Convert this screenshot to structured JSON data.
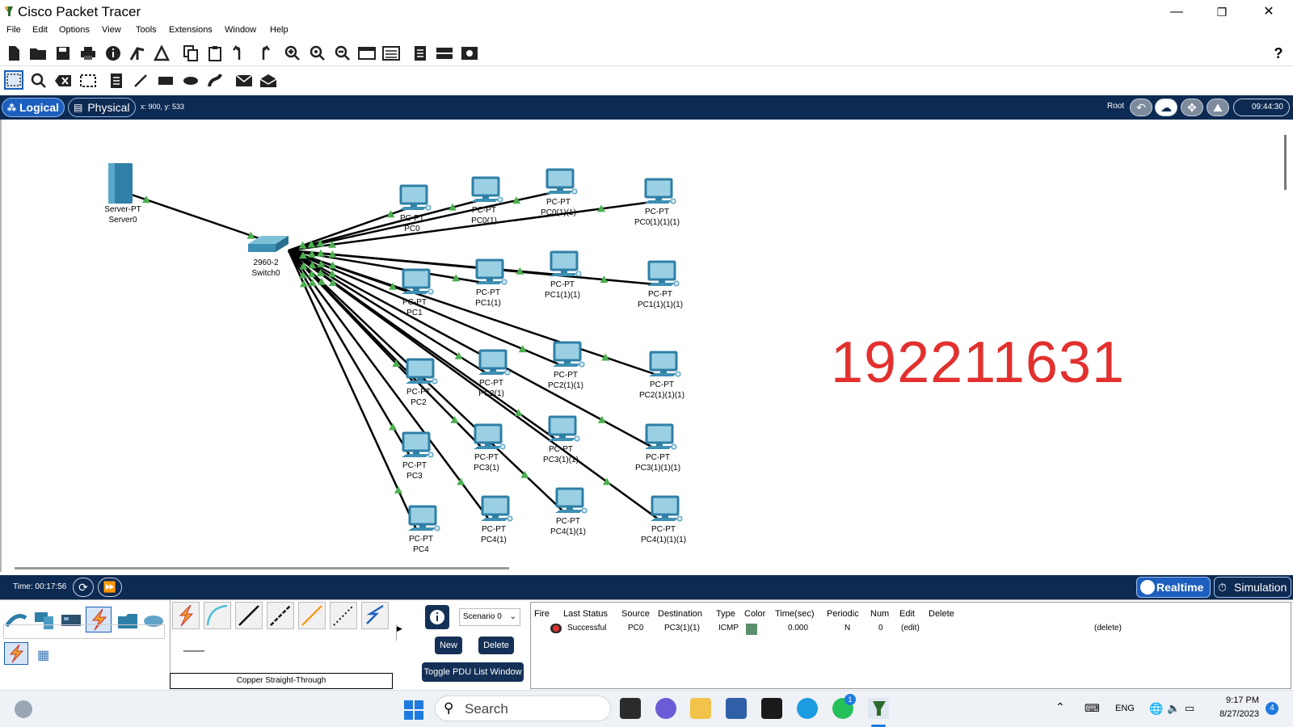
{
  "window": {
    "title": "Cisco Packet Tracer",
    "minimize": "—",
    "restore": "❐",
    "close": "✕"
  },
  "menu": [
    "File",
    "Edit",
    "Options",
    "View",
    "Tools",
    "Extensions",
    "Window",
    "Help"
  ],
  "toolbar1": {
    "help": "?"
  },
  "navbar": {
    "logical": "Logical",
    "physical": "Physical",
    "coords": "x: 900, y: 533",
    "root": "Root",
    "clock": "09:44:30"
  },
  "devices": {
    "server": {
      "type": "Server-PT",
      "name": "Server0"
    },
    "switch": {
      "type": "2960-2",
      "name": "Switch0"
    },
    "pcs": [
      {
        "type": "PC-PT",
        "name": "PC0"
      },
      {
        "type": "PC-PT",
        "name": "PC0(1)"
      },
      {
        "type": "PC-PT",
        "name": "PC0(1)(1)"
      },
      {
        "type": "PC-PT",
        "name": "PC0(1)(1)(1)"
      },
      {
        "type": "PC-PT",
        "name": "PC1"
      },
      {
        "type": "PC-PT",
        "name": "PC1(1)"
      },
      {
        "type": "PC-PT",
        "name": "PC1(1)(1)"
      },
      {
        "type": "PC-PT",
        "name": "PC1(1)(1)(1)"
      },
      {
        "type": "PC-PT",
        "name": "PC2"
      },
      {
        "type": "PC-PT",
        "name": "PC2(1)"
      },
      {
        "type": "PC-PT",
        "name": "PC2(1)(1)"
      },
      {
        "type": "PC-PT",
        "name": "PC2(1)(1)(1)"
      },
      {
        "type": "PC-PT",
        "name": "PC3"
      },
      {
        "type": "PC-PT",
        "name": "PC3(1)"
      },
      {
        "type": "PC-PT",
        "name": "PC3(1)(1)"
      },
      {
        "type": "PC-PT",
        "name": "PC3(1)(1)(1)"
      },
      {
        "type": "PC-PT",
        "name": "PC4"
      },
      {
        "type": "PC-PT",
        "name": "PC4(1)"
      },
      {
        "type": "PC-PT",
        "name": "PC4(1)(1)"
      },
      {
        "type": "PC-PT",
        "name": "PC4(1)(1)(1)"
      }
    ]
  },
  "watermark": "192211631",
  "timebar": {
    "time": "Time: 00:17:56",
    "realtime": "Realtime",
    "simulation": "Simulation"
  },
  "panel": {
    "cable_label": "Copper Straight-Through",
    "scenario": "Scenario 0",
    "new": "New",
    "delete": "Delete",
    "toggle": "Toggle PDU List Window",
    "pdu_headers": [
      "Fire",
      "Last Status",
      "Source",
      "Destination",
      "Type",
      "Color",
      "Time(sec)",
      "Periodic",
      "Num",
      "Edit",
      "Delete"
    ],
    "pdu_row": {
      "status": "Successful",
      "source": "PC0",
      "destination": "PC3(1)(1)",
      "type": "ICMP",
      "color": "#5a8f6c",
      "time": "0.000",
      "periodic": "N",
      "num": "0",
      "edit": "(edit)",
      "delete": "(delete)"
    }
  },
  "taskbar": {
    "search": "Search",
    "lang": "ENG",
    "time": "9:17 PM",
    "date": "8/27/2023",
    "badge": "4",
    "whatsapp_badge": "1"
  }
}
